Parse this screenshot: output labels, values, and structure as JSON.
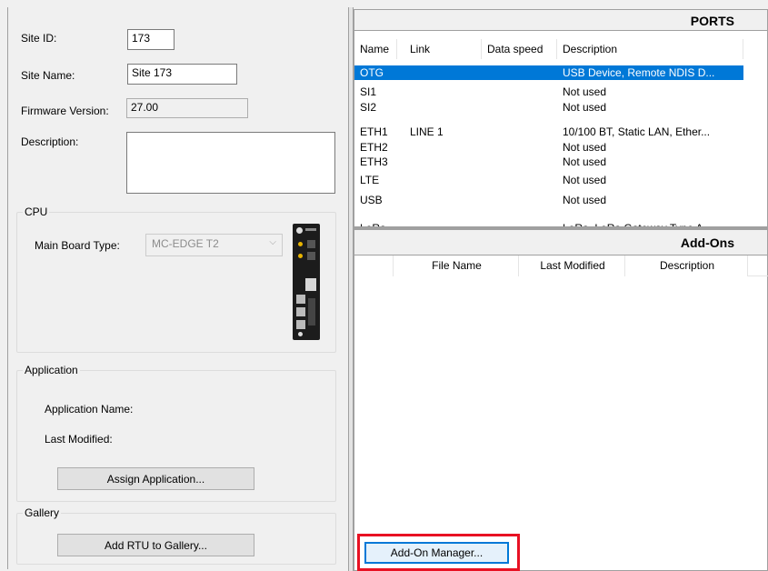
{
  "site": {
    "site_id_label": "Site ID:",
    "site_id_value": "173",
    "site_name_label": "Site Name:",
    "site_name_value": "Site 173",
    "firmware_label": "Firmware Version:",
    "firmware_value": "27.00",
    "description_label": "Description:",
    "description_value": ""
  },
  "cpu": {
    "group_title": "CPU",
    "board_type_label": "Main Board Type:",
    "board_type_value": "MC-EDGE T2",
    "board_icon": "rtu-board-image"
  },
  "application": {
    "group_title": "Application",
    "name_label": "Application Name:",
    "last_modified_label": "Last Modified:",
    "assign_button": "Assign Application..."
  },
  "gallery": {
    "group_title": "Gallery",
    "add_button": "Add RTU to Gallery..."
  },
  "ports": {
    "title": "PORTS",
    "columns": [
      "Name",
      "Link",
      "Data speed",
      "Description"
    ],
    "rows": [
      {
        "name": "OTG",
        "link": "",
        "speed": "",
        "desc": "USB Device, Remote NDIS D...",
        "selected": true
      },
      {
        "name": "SI1",
        "link": "",
        "speed": "",
        "desc": "Not used"
      },
      {
        "name": "SI2",
        "link": "",
        "speed": "",
        "desc": "Not used"
      },
      {
        "name": "ETH1",
        "link": "LINE 1",
        "speed": "",
        "desc": "10/100 BT, Static LAN, Ether..."
      },
      {
        "name": "ETH2",
        "link": "",
        "speed": "",
        "desc": "Not used"
      },
      {
        "name": "ETH3",
        "link": "",
        "speed": "",
        "desc": "Not used"
      },
      {
        "name": "LTE",
        "link": "",
        "speed": "",
        "desc": "Not used"
      },
      {
        "name": "USB",
        "link": "",
        "speed": "",
        "desc": "Not used"
      },
      {
        "name": "LoRa",
        "link": "",
        "speed": "",
        "desc": "LoRa, LoRa Gateway Type A"
      }
    ]
  },
  "addons": {
    "title": "Add-Ons",
    "columns": [
      "",
      "File Name",
      "Last Modified",
      "Description"
    ],
    "manager_button": "Add-On Manager..."
  },
  "colors": {
    "selection": "#0078d7",
    "highlight_box": "#e81123"
  }
}
